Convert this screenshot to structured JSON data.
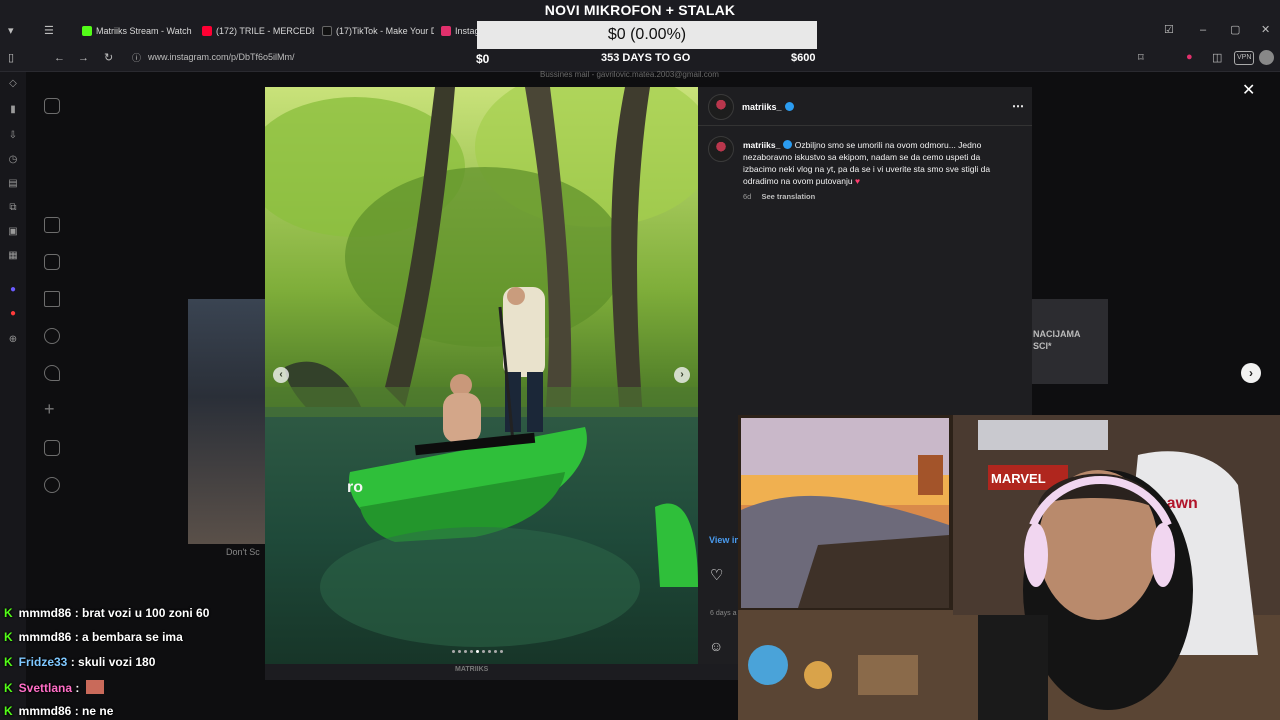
{
  "stream": {
    "title": "NOVI MIKROFON + STALAK",
    "goal_value": "$0 (0.00%)",
    "goal_current": "$0",
    "goal_days": "353 DAYS TO GO",
    "goal_target": "$600"
  },
  "browser": {
    "tabs": [
      {
        "label": "Matriiks Stream - Watch Li",
        "color": "#53fc18"
      },
      {
        "label": "(172) TRILE - MERCEDES BE",
        "color": "#ff0033"
      },
      {
        "label": "(17)TikTok - Make Your Day",
        "color": "#111111"
      },
      {
        "label": "Instag",
        "color": "#e1306c"
      }
    ],
    "url": "www.instagram.com/p/DbTf6o5ilMm/"
  },
  "background": {
    "bussines_mail": "Bussines mail - gavrilovic.matea.2003@gmail.com",
    "side_card_text": "NACIJAMA",
    "side_card_text2": "SCI*",
    "dont_text": "Don't Sc"
  },
  "post": {
    "username": "matriiks_",
    "caption_user": "matriiks_",
    "caption_text": "Ozbiljno smo se umorili na ovom odmoru... Jedno nezaboravno iskustvo sa ekipom, nadam se da cemo uspeti da izbacimo neki vlog na yt, pa da se i vi uverite sta smo sve stigli da odradimo na ovom putovanju",
    "time": "6d",
    "see_translation": "See translation",
    "view_insights": "View in",
    "likes_days": "6 days a",
    "more_icon": "more-dots-icon",
    "watermark": "MATRIIKS",
    "carousel_dots": 9,
    "active_dot": 5
  },
  "chat": [
    {
      "user": "mmmd86",
      "color": "#ffffff",
      "message": ": brat vozi u 100 zoni 60"
    },
    {
      "user": "mmmd86",
      "color": "#ffffff",
      "message": ": a bembara se ima"
    },
    {
      "user": "Fridze33",
      "color": "#ffffff",
      "message": ": skuli vozi 180"
    },
    {
      "user": "Svettlana",
      "color": "#ff6ec7",
      "message": ":"
    },
    {
      "user": "mmmd86",
      "color": "#ffffff",
      "message": ": ne ne"
    }
  ],
  "webcam": {
    "chair_brand": "spawn",
    "poster_text": "MARVEL"
  }
}
